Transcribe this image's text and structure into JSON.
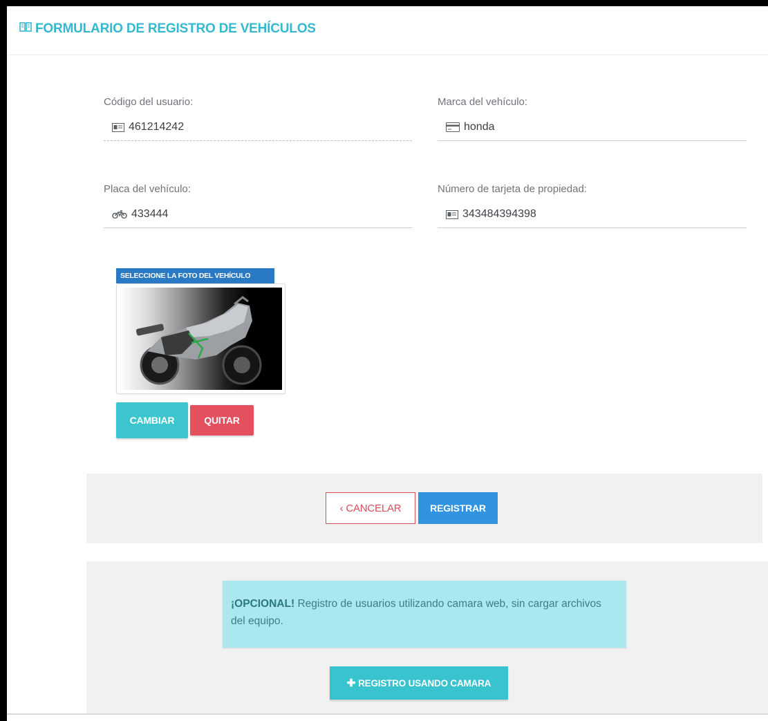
{
  "header": {
    "title": "FORMULARIO DE REGISTRO DE VEHÍCULOS"
  },
  "fields": {
    "codigo": {
      "label": "Código del usuario:",
      "value": "461214242"
    },
    "marca": {
      "label": "Marca del vehículo:",
      "value": "honda"
    },
    "placa": {
      "label": "Placa del vehículo:",
      "value": "433444"
    },
    "tarjeta": {
      "label": "Número de tarjeta de propiedad:",
      "value": "343484394398"
    }
  },
  "photo": {
    "tag_label": "SELECCIONE LA FOTO DEL VEHÍCULO",
    "change_label": "CAMBIAR",
    "remove_label": "QUITAR"
  },
  "actions": {
    "cancel_label": "‹ CANCELAR",
    "register_label": "REGISTRAR"
  },
  "optional": {
    "strong": "¡OPCIONAL!",
    "text": " Registro de usuarios utilizando camara web, sin cargar archivos del equipo.",
    "camera_button_label": "REGISTRO USANDO CAMARA"
  },
  "colors": {
    "accent": "#34b8cf",
    "primary": "#3294e0",
    "danger": "#e5505e",
    "info": "#3cc5cf",
    "alert_bg": "#aae7ee"
  },
  "icons": {
    "header": "book-icon",
    "codigo": "id-card-icon",
    "marca": "credit-card-icon",
    "placa": "motorcycle-icon",
    "tarjeta": "id-card-icon",
    "camera_button": "plus-icon"
  }
}
